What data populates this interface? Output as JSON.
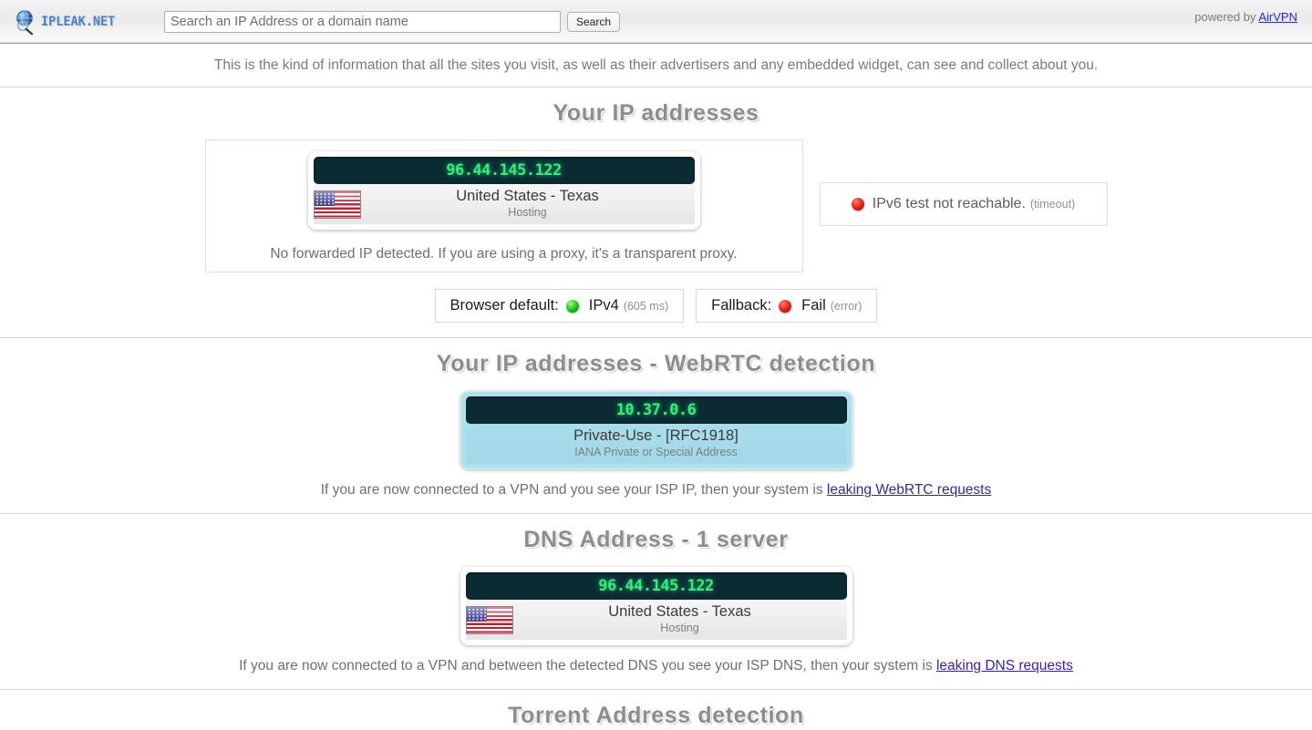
{
  "header": {
    "logo_text": "IPLEAK.NET",
    "logo_icon": "globe-magnifier-icon",
    "search_placeholder": "Search an IP Address or a domain name",
    "search_value": "",
    "search_button": "Search",
    "powered_by_prefix": "powered by ",
    "powered_by_link": "AirVPN"
  },
  "subtitle": "This is the kind of information that all the sites you visit, as well as their advertisers and any embedded widget, can see and collect about you.",
  "section_ip": {
    "title": "Your IP addresses",
    "card": {
      "ip": "96.44.145.122",
      "flag": "us-flag-icon",
      "location": "United States - Texas",
      "subtext": "Hosting"
    },
    "forwarded_note": "No forwarded IP detected. If you are using a proxy, it's a transparent proxy.",
    "ipv6": {
      "dot": "red",
      "text": "IPv6 test not reachable.",
      "detail": "(timeout)"
    },
    "status_boxes": [
      {
        "label": "Browser default:",
        "dot": "green",
        "value": "IPv4",
        "detail": "(605 ms)"
      },
      {
        "label": "Fallback:",
        "dot": "red",
        "value": "Fail",
        "detail": "(error)"
      }
    ]
  },
  "section_webrtc": {
    "title": "Your IP addresses - WebRTC detection",
    "card": {
      "ip": "10.37.0.6",
      "location": "Private-Use - [RFC1918]",
      "subtext": "IANA Private or Special Address"
    },
    "footnote_prefix": "If you are now connected to a VPN and you see your ISP IP, then your system is ",
    "footnote_link": "leaking WebRTC requests"
  },
  "section_dns": {
    "title": "DNS Address - 1 server",
    "card": {
      "ip": "96.44.145.122",
      "flag": "us-flag-icon",
      "location": "United States - Texas",
      "subtext": "Hosting"
    },
    "footnote_prefix": "If you are now connected to a VPN and between the detected DNS you see your ISP DNS, then your system is ",
    "footnote_link": "leaking DNS requests"
  },
  "section_torrent": {
    "title": "Torrent Address detection"
  },
  "colors": {
    "ip_green": "#2ff07a",
    "ip_panel_dark": "#0b2b33",
    "webrtc_blue": "#aee0ed",
    "heading_gray": "#8d8d8d",
    "link_purple": "#3b23a8",
    "link_blue": "#2a2ad0"
  }
}
